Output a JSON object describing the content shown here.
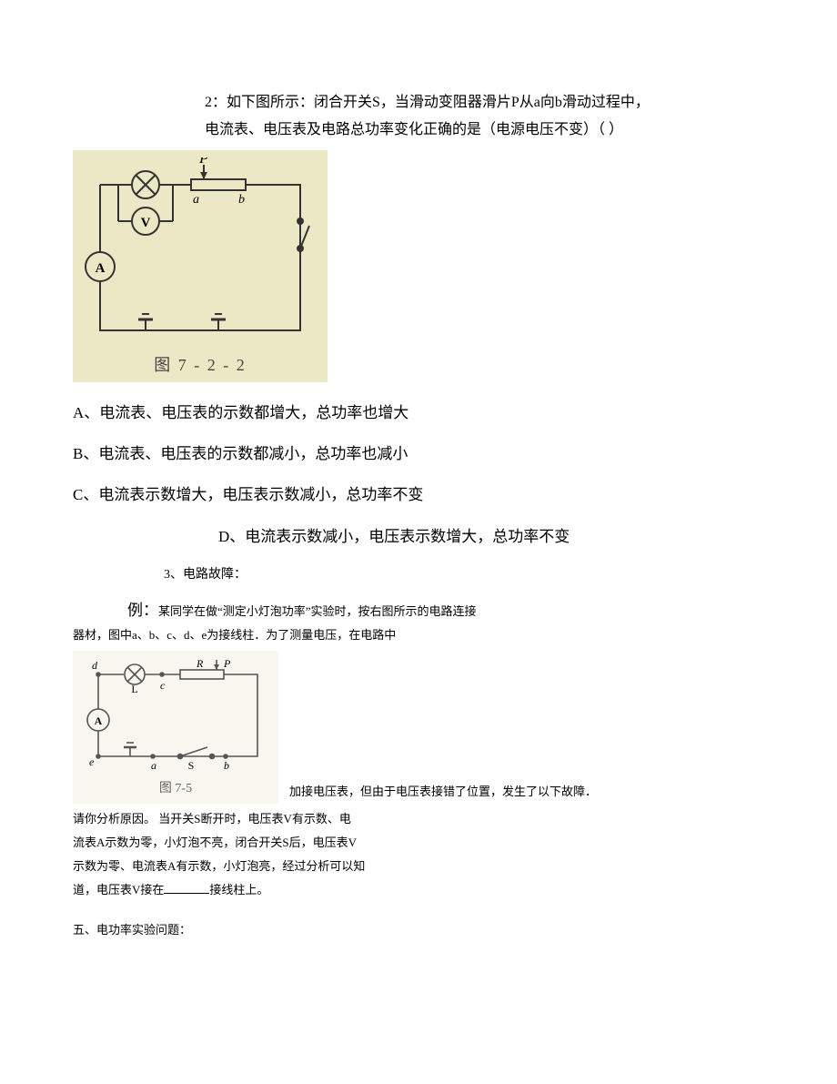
{
  "q2": {
    "stem_l1": "2：如下图所示：闭合开关S，当滑动变阻器滑片P从a向b滑动过程中，",
    "stem_l2": "电流表、电压表及电路总功率变化正确的是（电源电压不变）（  ）",
    "fig_caption": "图 7 - 2 - 2",
    "fig_labels": {
      "P": "P",
      "a": "a",
      "b": "b",
      "V": "V",
      "A": "A",
      "lamp": "×"
    },
    "options": {
      "A": "A、电流表、电压表的示数都增大，总功率也增大",
      "B": "B、电流表、电压表的示数都减小，总功率也减小",
      "C": "C、电流表示数增大，电压表示数减小，总功率不变",
      "D": "D、电流表示数减小，电压表示数增大，总功率不变"
    }
  },
  "q3": {
    "heading": "3、电路故障：",
    "ex_label": "例：",
    "ex_l1": "某同学在做“测定小灯泡功率”实验时，按右图所示的电路连接",
    "ex_l2": "器材，图中a、b、c、d、e为接线柱．为了测量电压，在电路中",
    "fig_caption": "图 7-5",
    "fig_labels": {
      "d": "d",
      "c": "c",
      "e": "e",
      "a": "a",
      "b": "b",
      "L": "L",
      "S": "S",
      "R": "R",
      "P": "P",
      "A": "A"
    },
    "after_fig": "加接电压表，但由于电压表接错了位置，发生了以下故障．",
    "lines": [
      "请你分析原因。 当开关S断开时，电压表V有示数、电",
      "流表A示数为零，小灯泡不亮，闭合开关S后，电压表V",
      "示数为零、电流表A有示数，小灯泡亮，经过分析可以知",
      "道，电压表V接在______接线柱上。"
    ]
  },
  "section5": "五、电功率实验问题："
}
